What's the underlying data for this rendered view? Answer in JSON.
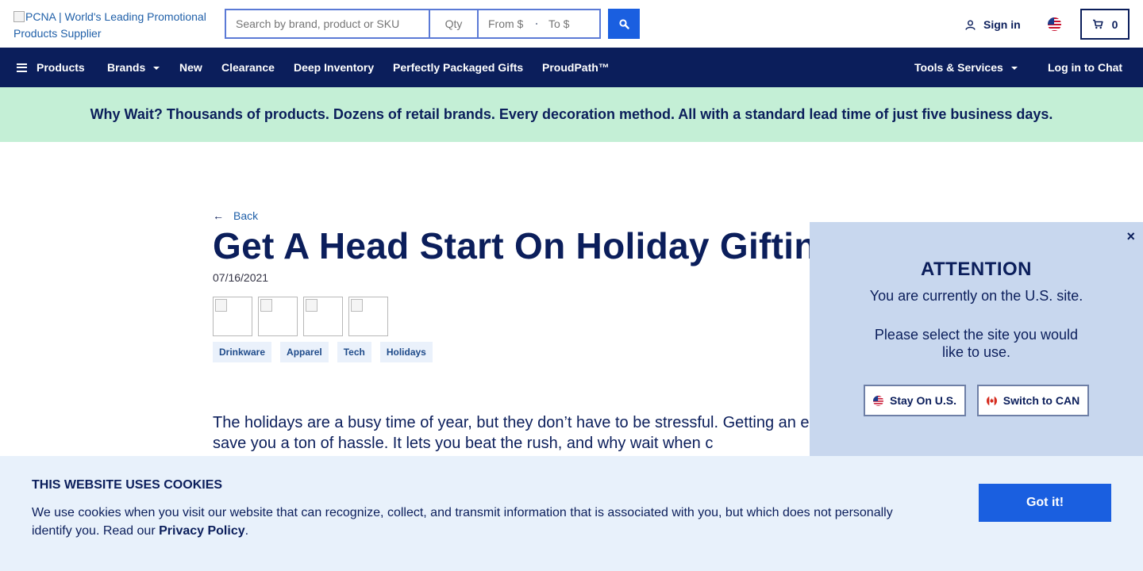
{
  "header": {
    "logo_alt": "PCNA | World's Leading Promotional Products Supplier",
    "search": {
      "placeholder": "Search by brand, product or SKU"
    },
    "qty": {
      "placeholder": "Qty"
    },
    "price_from": {
      "placeholder": "From $"
    },
    "price_to": {
      "placeholder": "To $"
    },
    "sign_in_label": "Sign in",
    "cart_count": "0"
  },
  "nav": {
    "items": [
      {
        "label": "Products"
      },
      {
        "label": "Brands"
      },
      {
        "label": "New"
      },
      {
        "label": "Clearance"
      },
      {
        "label": "Deep Inventory"
      },
      {
        "label": "Perfectly Packaged Gifts"
      },
      {
        "label": "ProudPath™"
      }
    ],
    "tools_label": "Tools & Services",
    "chat_label": "Log in to Chat"
  },
  "promo_banner": "Why Wait? Thousands of products. Dozens of retail brands. Every decoration method. All with a standard lead time of just five business days.",
  "article": {
    "back_label": "Back",
    "title": "Get A Head Start On Holiday Gifting",
    "date": "07/16/2021",
    "tags": [
      "Drinkware",
      "Apparel",
      "Tech",
      "Holidays"
    ],
    "intro": "The holidays are a busy time of year, but they don’t have to be stressful. Getting an early start on your holiday shopping can save you a ton of hassle. It lets you beat the rush, and why wait when c"
  },
  "site_modal": {
    "close_label": "×",
    "title": "ATTENTION",
    "line1": "You are currently on the U.S. site.",
    "line2": "Please select the site you would like to use.",
    "stay_label": "Stay On U.S.",
    "switch_label": "Switch to CAN"
  },
  "cookie_banner": {
    "title": "THIS WEBSITE USES COOKIES",
    "text": "We use cookies when you visit our website that can recognize, collect, and transmit information that is associated with you, but which does not personally identify you. Read our ",
    "link_label": "Privacy Policy",
    "text_end": ".",
    "button_label": "Got it!"
  },
  "colors": {
    "navy": "#0b1e5b",
    "accent_blue": "#1a5fe0",
    "promo_green": "#c4efd6",
    "modal_bg": "#c8d7ee",
    "cookie_bg": "#e8f1fb"
  }
}
